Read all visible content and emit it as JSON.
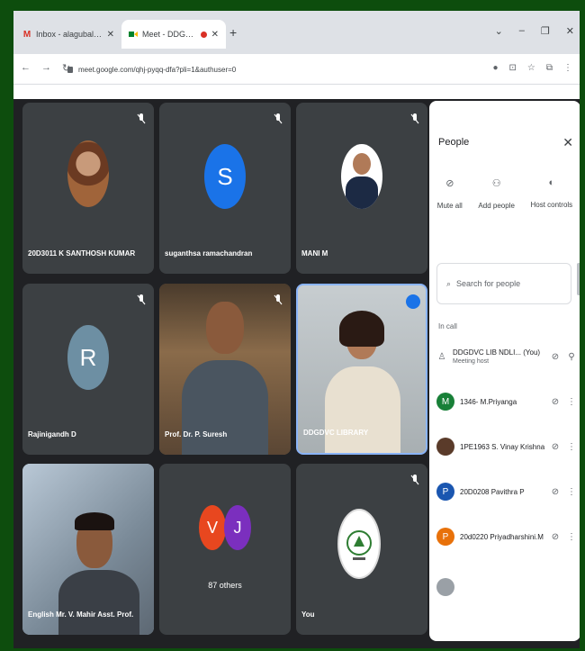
{
  "tabs": [
    {
      "label": "Inbox - alagubalamuthukkatu@gma",
      "icon": "gmail-icon"
    },
    {
      "label": "Meet - DDGDVC Library NDLI",
      "icon": "meet-icon"
    }
  ],
  "address": {
    "url": "meet.google.com/qhj-pyqq-dfa?pli=1&authuser=0"
  },
  "tiles": [
    {
      "name": "20D3011 K SANTHOSH KUMAR"
    },
    {
      "name": "suganthsa ramachandran",
      "initial": "S",
      "color": "#1a73e8"
    },
    {
      "name": "MANI M"
    },
    {
      "name": "Rajinigandh D",
      "initial": "R",
      "color": "#6d8fa3"
    },
    {
      "name": "Prof. Dr. P. Suresh"
    },
    {
      "name": "DDGDVC LIBRARY"
    },
    {
      "name": "English Mr. V. Mahir Asst. Prof."
    },
    {
      "name": "87 others",
      "initials": [
        "V",
        "J"
      ],
      "colors": [
        "#e8471f",
        "#7b2fbe"
      ]
    },
    {
      "name": "You"
    }
  ],
  "panel": {
    "title": "People",
    "actions": [
      "Mute all",
      "Add people",
      "Host controls"
    ],
    "search_placeholder": "Search for people",
    "section": "In call",
    "participants": [
      {
        "name": "DDGDVC LIB NDLI... (You)",
        "sub": "Meeting host"
      },
      {
        "name": "1346- M.Priyanga",
        "initial": "M",
        "color": "#188038"
      },
      {
        "name": "1PE1963 S. Vinay Krishna"
      },
      {
        "name": "20D0208 Pavithra P",
        "initial": "P",
        "color": "#1a56b0"
      },
      {
        "name": "20d0220 Priyadharshini.M",
        "initial": "P",
        "color": "#e8710a"
      }
    ]
  }
}
